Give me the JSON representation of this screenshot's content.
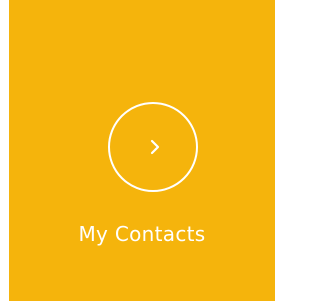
{
  "tile": {
    "label": "My Contacts",
    "background_color": "#F5B40C",
    "foreground_color": "#FFFFFF",
    "icon": "chevron-right-icon"
  }
}
